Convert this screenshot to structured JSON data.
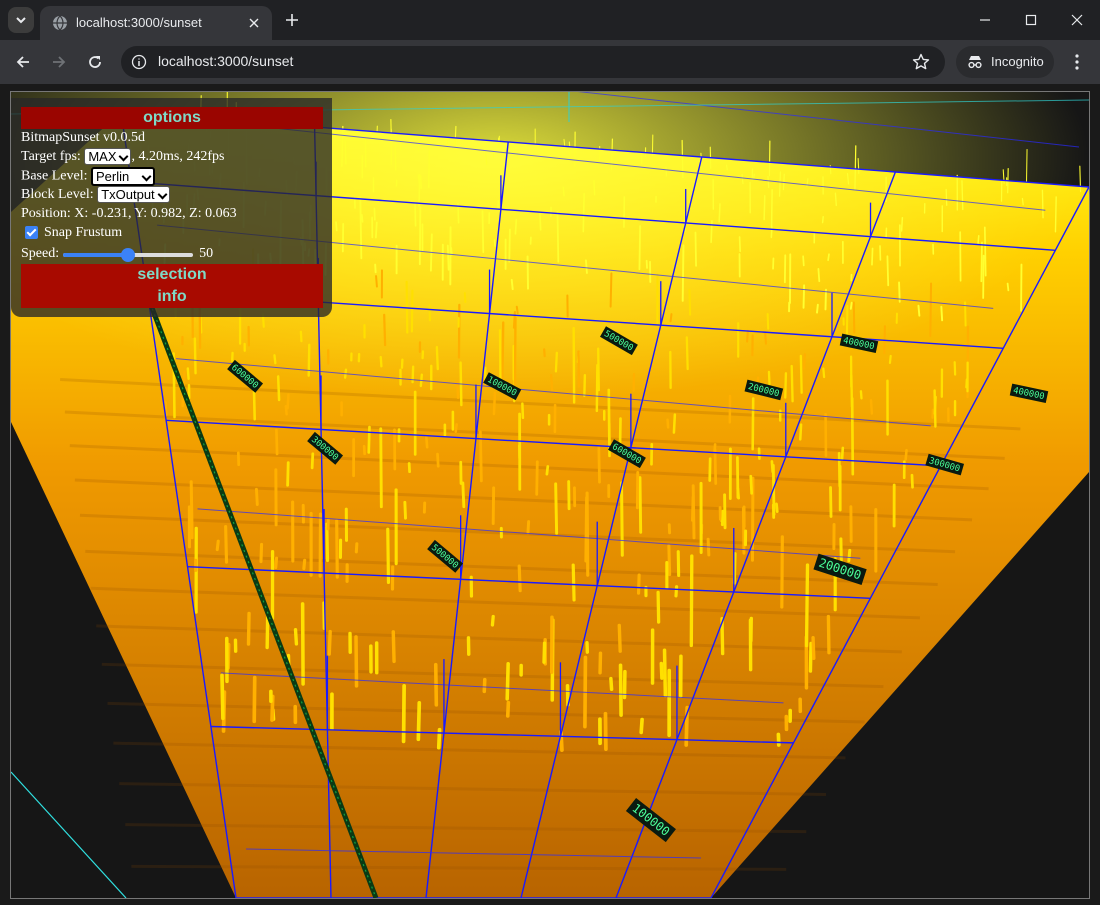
{
  "browser": {
    "tab_title": "localhost:3000/sunset",
    "url": "localhost:3000/sunset",
    "incognito_label": "Incognito"
  },
  "icons": [
    "tab-search-icon",
    "globe-icon",
    "close-icon",
    "plus-icon",
    "minimize-icon",
    "maximize-icon",
    "window-close-icon",
    "back-icon",
    "forward-icon",
    "reload-icon",
    "info-icon",
    "star-icon",
    "incognito-icon",
    "kebab-menu-icon"
  ],
  "panel": {
    "options_label": "options",
    "app_name": "BitmapSunset v0.0.5d",
    "target_fps_label": "Target fps:",
    "target_fps_value": "MAX",
    "fps_stats": ", 4.20ms, 242fps",
    "base_level_label": "Base Level:",
    "base_level_value": "Perlin",
    "block_level_label": "Block Level:",
    "block_level_value": "TxOutput",
    "position_text": "Position: X: -0.231, Y: 0.982, Z: 0.063",
    "snap_frustum_label": "Snap Frustum",
    "snap_frustum_checked": true,
    "speed_label": "Speed:",
    "speed_value": "50",
    "speed_fraction": 0.5,
    "selection_label": "selection",
    "info_label": "info"
  },
  "scene_labels": [
    "100000",
    "200000",
    "300000",
    "400000",
    "500000",
    "600000"
  ],
  "colors": {
    "header_red": "#9a0500",
    "header_text": "#7fd9c6",
    "terrain_orange": "#e08a00",
    "terrain_yellow": "#ffee00",
    "grid_blue": "#1a1aff",
    "label_green": "#4cff9a"
  }
}
